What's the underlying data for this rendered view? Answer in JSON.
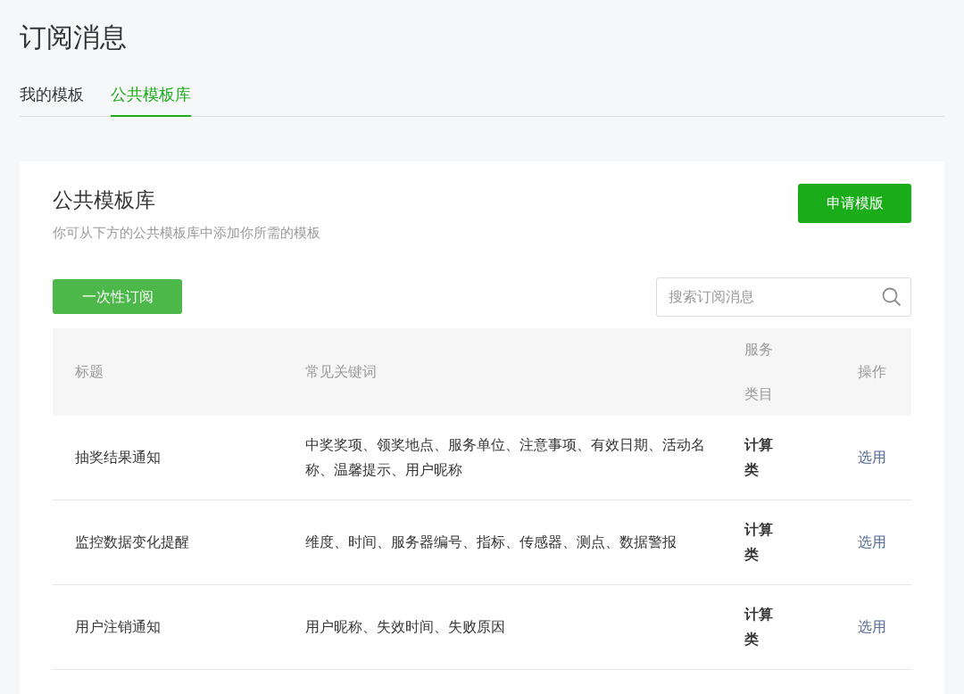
{
  "page_title": "订阅消息",
  "tabs": [
    {
      "label": "我的模板",
      "selected": false
    },
    {
      "label": "公共模板库",
      "selected": true
    }
  ],
  "card": {
    "title": "公共模板库",
    "subtitle": "你可从下方的公共模板库中添加你所需的模板",
    "apply_button": "申请模版",
    "filter_button": "一次性订阅",
    "search": {
      "placeholder": "搜索订阅消息"
    },
    "table": {
      "columns": [
        "标题",
        "常见关键词",
        "服务类目",
        "操作"
      ],
      "rows": [
        {
          "title": "抽奖结果通知",
          "keywords": "中奖奖项、领奖地点、服务单位、注意事项、有效日期、活动名称、温馨提示、用户昵称",
          "category": "计算类",
          "action": "选用"
        },
        {
          "title": "监控数据变化提醒",
          "keywords": "维度、时间、服务器编号、指标、传感器、测点、数据警报",
          "category": "计算类",
          "action": "选用"
        },
        {
          "title": "用户注销通知",
          "keywords": "用户昵称、失效时间、失败原因",
          "category": "计算类",
          "action": "选用"
        }
      ]
    }
  }
}
